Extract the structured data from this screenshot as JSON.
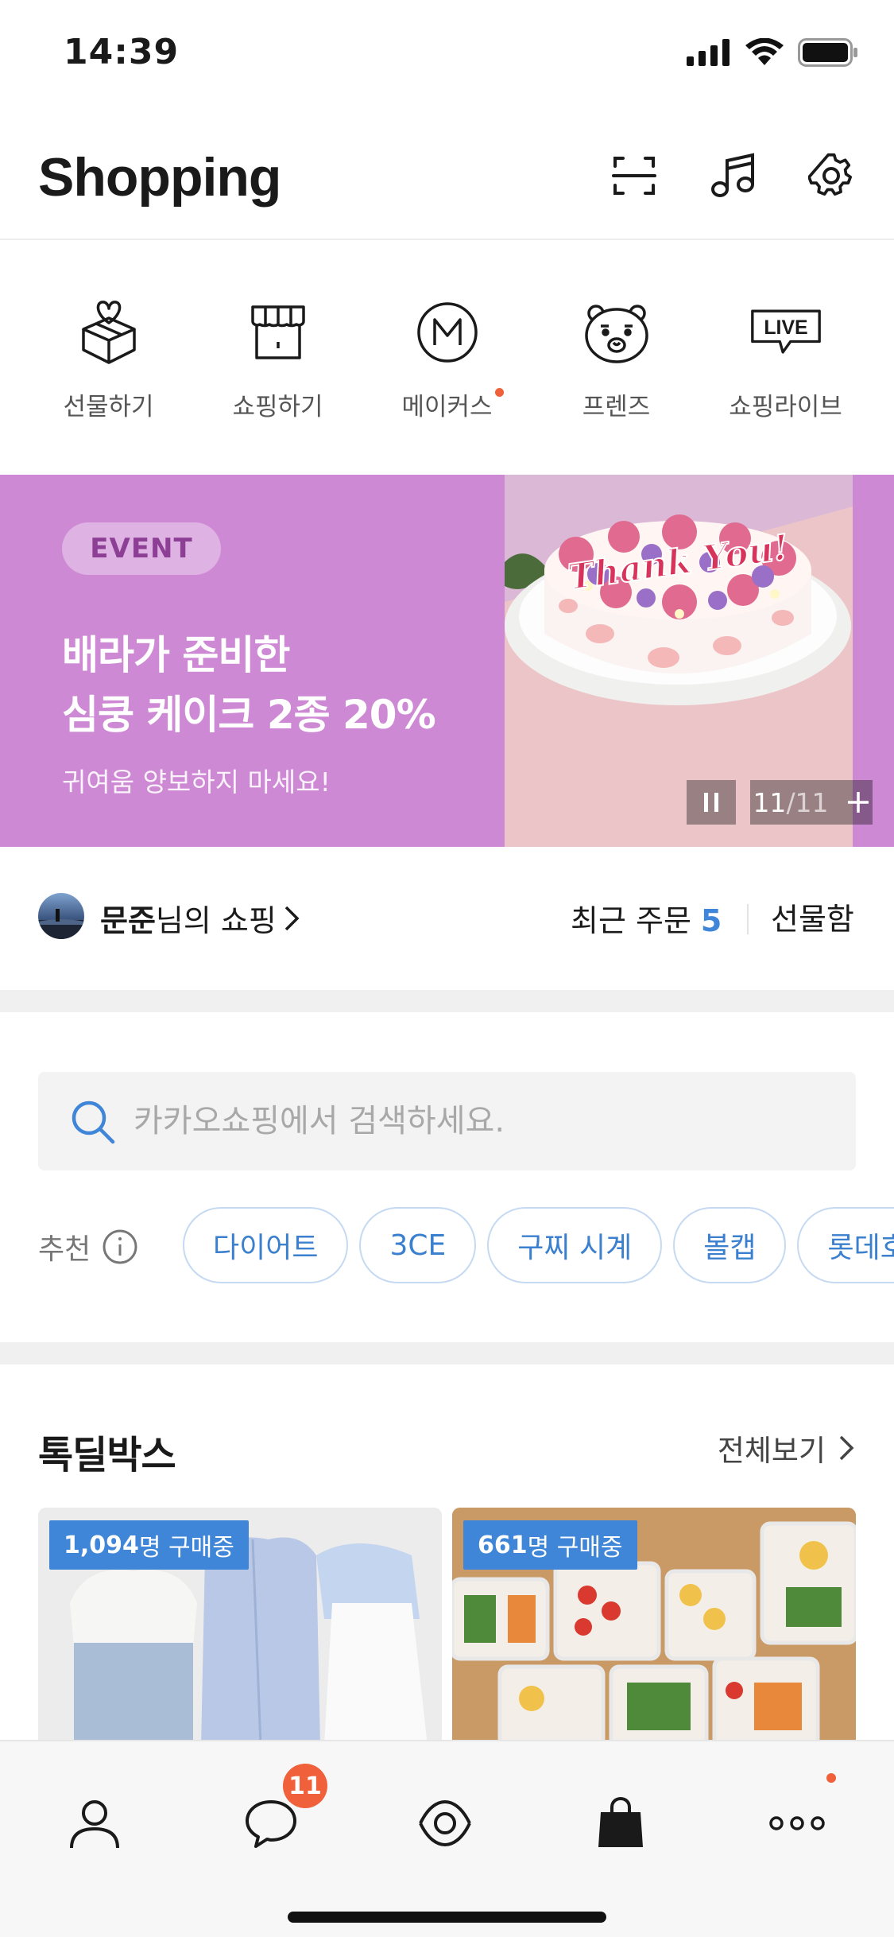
{
  "status_bar": {
    "time": "14:39"
  },
  "header": {
    "title": "Shopping",
    "icons": [
      "scan-icon",
      "music-note-icon",
      "gear-icon"
    ]
  },
  "categories": [
    {
      "label": "선물하기",
      "icon": "gift-box-icon"
    },
    {
      "label": "쇼핑하기",
      "icon": "store-icon"
    },
    {
      "label": "메이커스",
      "icon": "makers-m-icon",
      "new_dot": true
    },
    {
      "label": "프렌즈",
      "icon": "friends-bear-icon"
    },
    {
      "label": "쇼핑라이브",
      "icon": "live-icon",
      "icon_text": "LIVE"
    }
  ],
  "banner": {
    "tag": "EVENT",
    "title_line1": "배라가 준비한",
    "title_line2": "심쿵 케이크 2종 20%",
    "subtitle": "귀여움 양보하지 마세요!",
    "cake_text": "Thank You!",
    "current": "11",
    "total": "/11",
    "background": "#cd89d3"
  },
  "profile": {
    "name": "문준",
    "suffix": "님의 쇼핑",
    "recent_orders_label": "최근 주문",
    "recent_orders_count": "5",
    "gift_box": "선물함"
  },
  "search": {
    "placeholder": "카카오쇼핑에서 검색하세요."
  },
  "recommended": {
    "label": "추천",
    "chips": [
      "다이어트",
      "3CE",
      "구찌 시계",
      "볼캡",
      "롯데호텔"
    ]
  },
  "talkdeal": {
    "title": "톡딜박스",
    "view_all": "전체보기",
    "cards": [
      {
        "count": "1,094",
        "suffix": "명 구매중"
      },
      {
        "count": "661",
        "suffix": "명 구매중"
      }
    ]
  },
  "bottom_nav": {
    "items": [
      "person-icon",
      "chat-bubble-icon",
      "eye-view-icon",
      "shopping-bag-icon",
      "more-dots-icon"
    ],
    "chat_badge": "11"
  },
  "colors": {
    "accent": "#3f86d8",
    "badge": "#f0603a",
    "banner": "#cd89d3"
  }
}
